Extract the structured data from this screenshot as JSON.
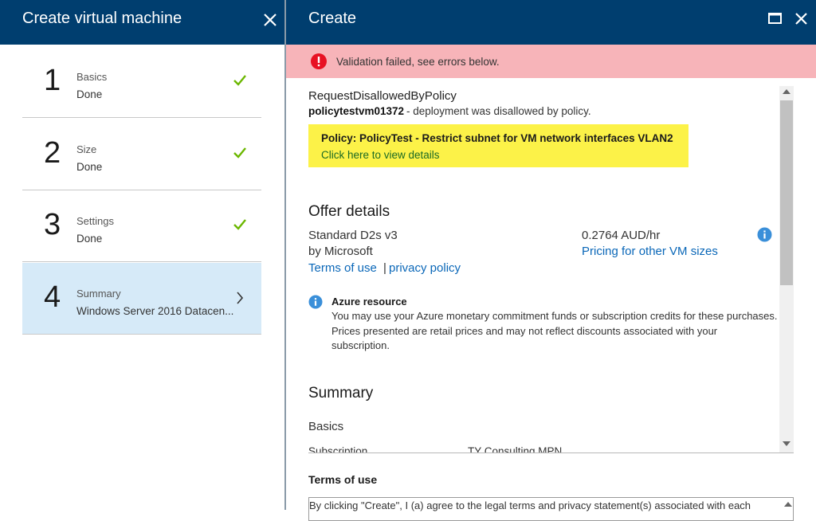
{
  "left_blade": {
    "title": "Create virtual machine",
    "steps": [
      {
        "number": "1",
        "title": "Basics",
        "status": "Done"
      },
      {
        "number": "2",
        "title": "Size",
        "status": "Done"
      },
      {
        "number": "3",
        "title": "Settings",
        "status": "Done"
      },
      {
        "number": "4",
        "title": "Summary",
        "status": "Windows Server 2016 Datacen..."
      }
    ]
  },
  "right_blade": {
    "title": "Create",
    "validation_message": "Validation failed, see errors below.",
    "error": {
      "code": "RequestDisallowedByPolicy",
      "vm_name": "policytestvm01372",
      "message": " - deployment was disallowed by policy."
    },
    "policy": {
      "title": "Policy: PolicyTest - Restrict subnet for VM network interfaces VLAN2",
      "link": "Click here to view details"
    },
    "offer": {
      "heading": "Offer details",
      "name": "Standard D2s v3",
      "publisher": "by Microsoft",
      "terms_link": "Terms of use",
      "separator": "|",
      "privacy_link": "privacy policy",
      "price": "0.2764 AUD/hr",
      "pricing_link": "Pricing for other VM sizes"
    },
    "azure_resource": {
      "title": "Azure resource",
      "body": "You may use your Azure monetary commitment funds or subscription credits for these purchases. Prices presented are retail prices and may not reflect discounts associated with your subscription."
    },
    "summary": {
      "heading": "Summary",
      "basics": "Basics",
      "subscription_label": "Subscription",
      "subscription_value": "TY Consulting MPN"
    },
    "terms": {
      "heading": "Terms of use",
      "text": "By clicking \"Create\", I (a) agree to the legal terms and privacy statement(s) associated with each"
    }
  },
  "colors": {
    "header_bg": "#003e6f",
    "error_banner": "#f7b4b9",
    "policy_highlight": "#fcf248",
    "link_blue": "#0a67b8",
    "success_check": "#6bb700",
    "active_step_bg": "#d6eaf8"
  },
  "icons": [
    "close-icon",
    "maximize-icon",
    "error-icon",
    "check-icon",
    "chevron-right-icon",
    "info-icon"
  ]
}
